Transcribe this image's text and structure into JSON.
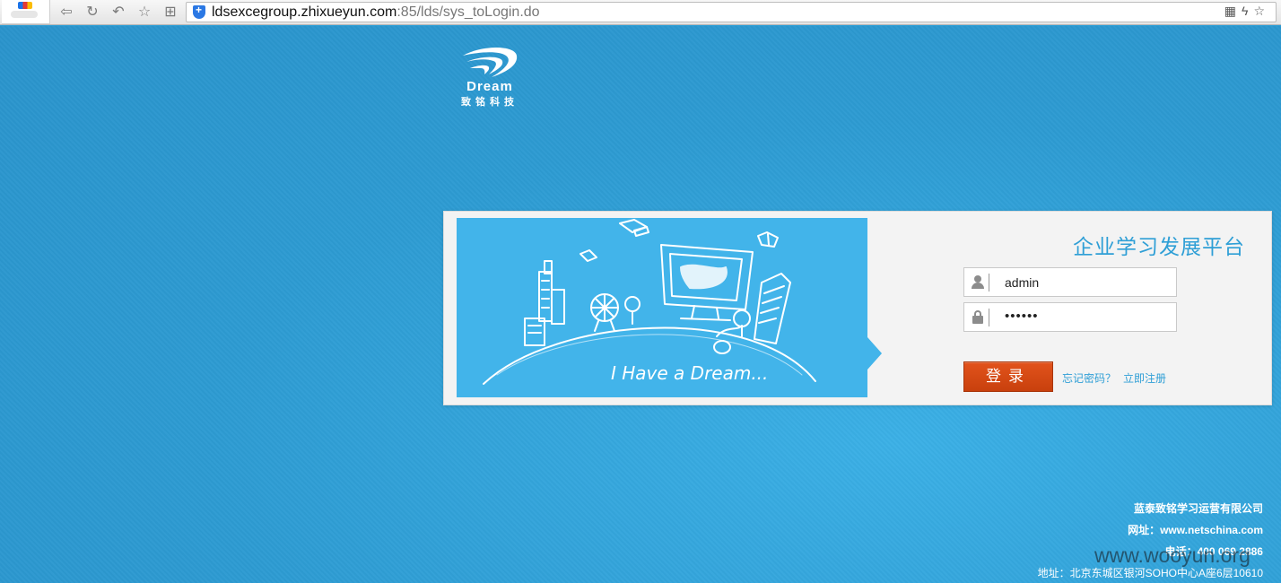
{
  "browser": {
    "url_host": "ldsexcegroup.zhixueyun.com",
    "url_rest": ":85/lds/sys_toLogin.do"
  },
  "logo": {
    "en": "Dream",
    "cn": "致铭科技"
  },
  "banner": {
    "slogan": "I Have a Dream..."
  },
  "login": {
    "title": "企业学习发展平台",
    "username_value": "admin",
    "password_value": "••••••",
    "login_label": "登录",
    "forgot_label": "忘记密码？",
    "register_label": "立即注册"
  },
  "footer": {
    "company": "蓝泰致铭学习运营有限公司",
    "website": "网址：www.netschina.com",
    "phone": "电话：400 069 2886",
    "address": "地址：北京东城区银河SOHO中心A座6层10610"
  },
  "watermark": "www.wooyun.org",
  "colors": {
    "background": "#2f9fd6",
    "accent": "#2f9fd6",
    "login_button": "#d64a15"
  }
}
